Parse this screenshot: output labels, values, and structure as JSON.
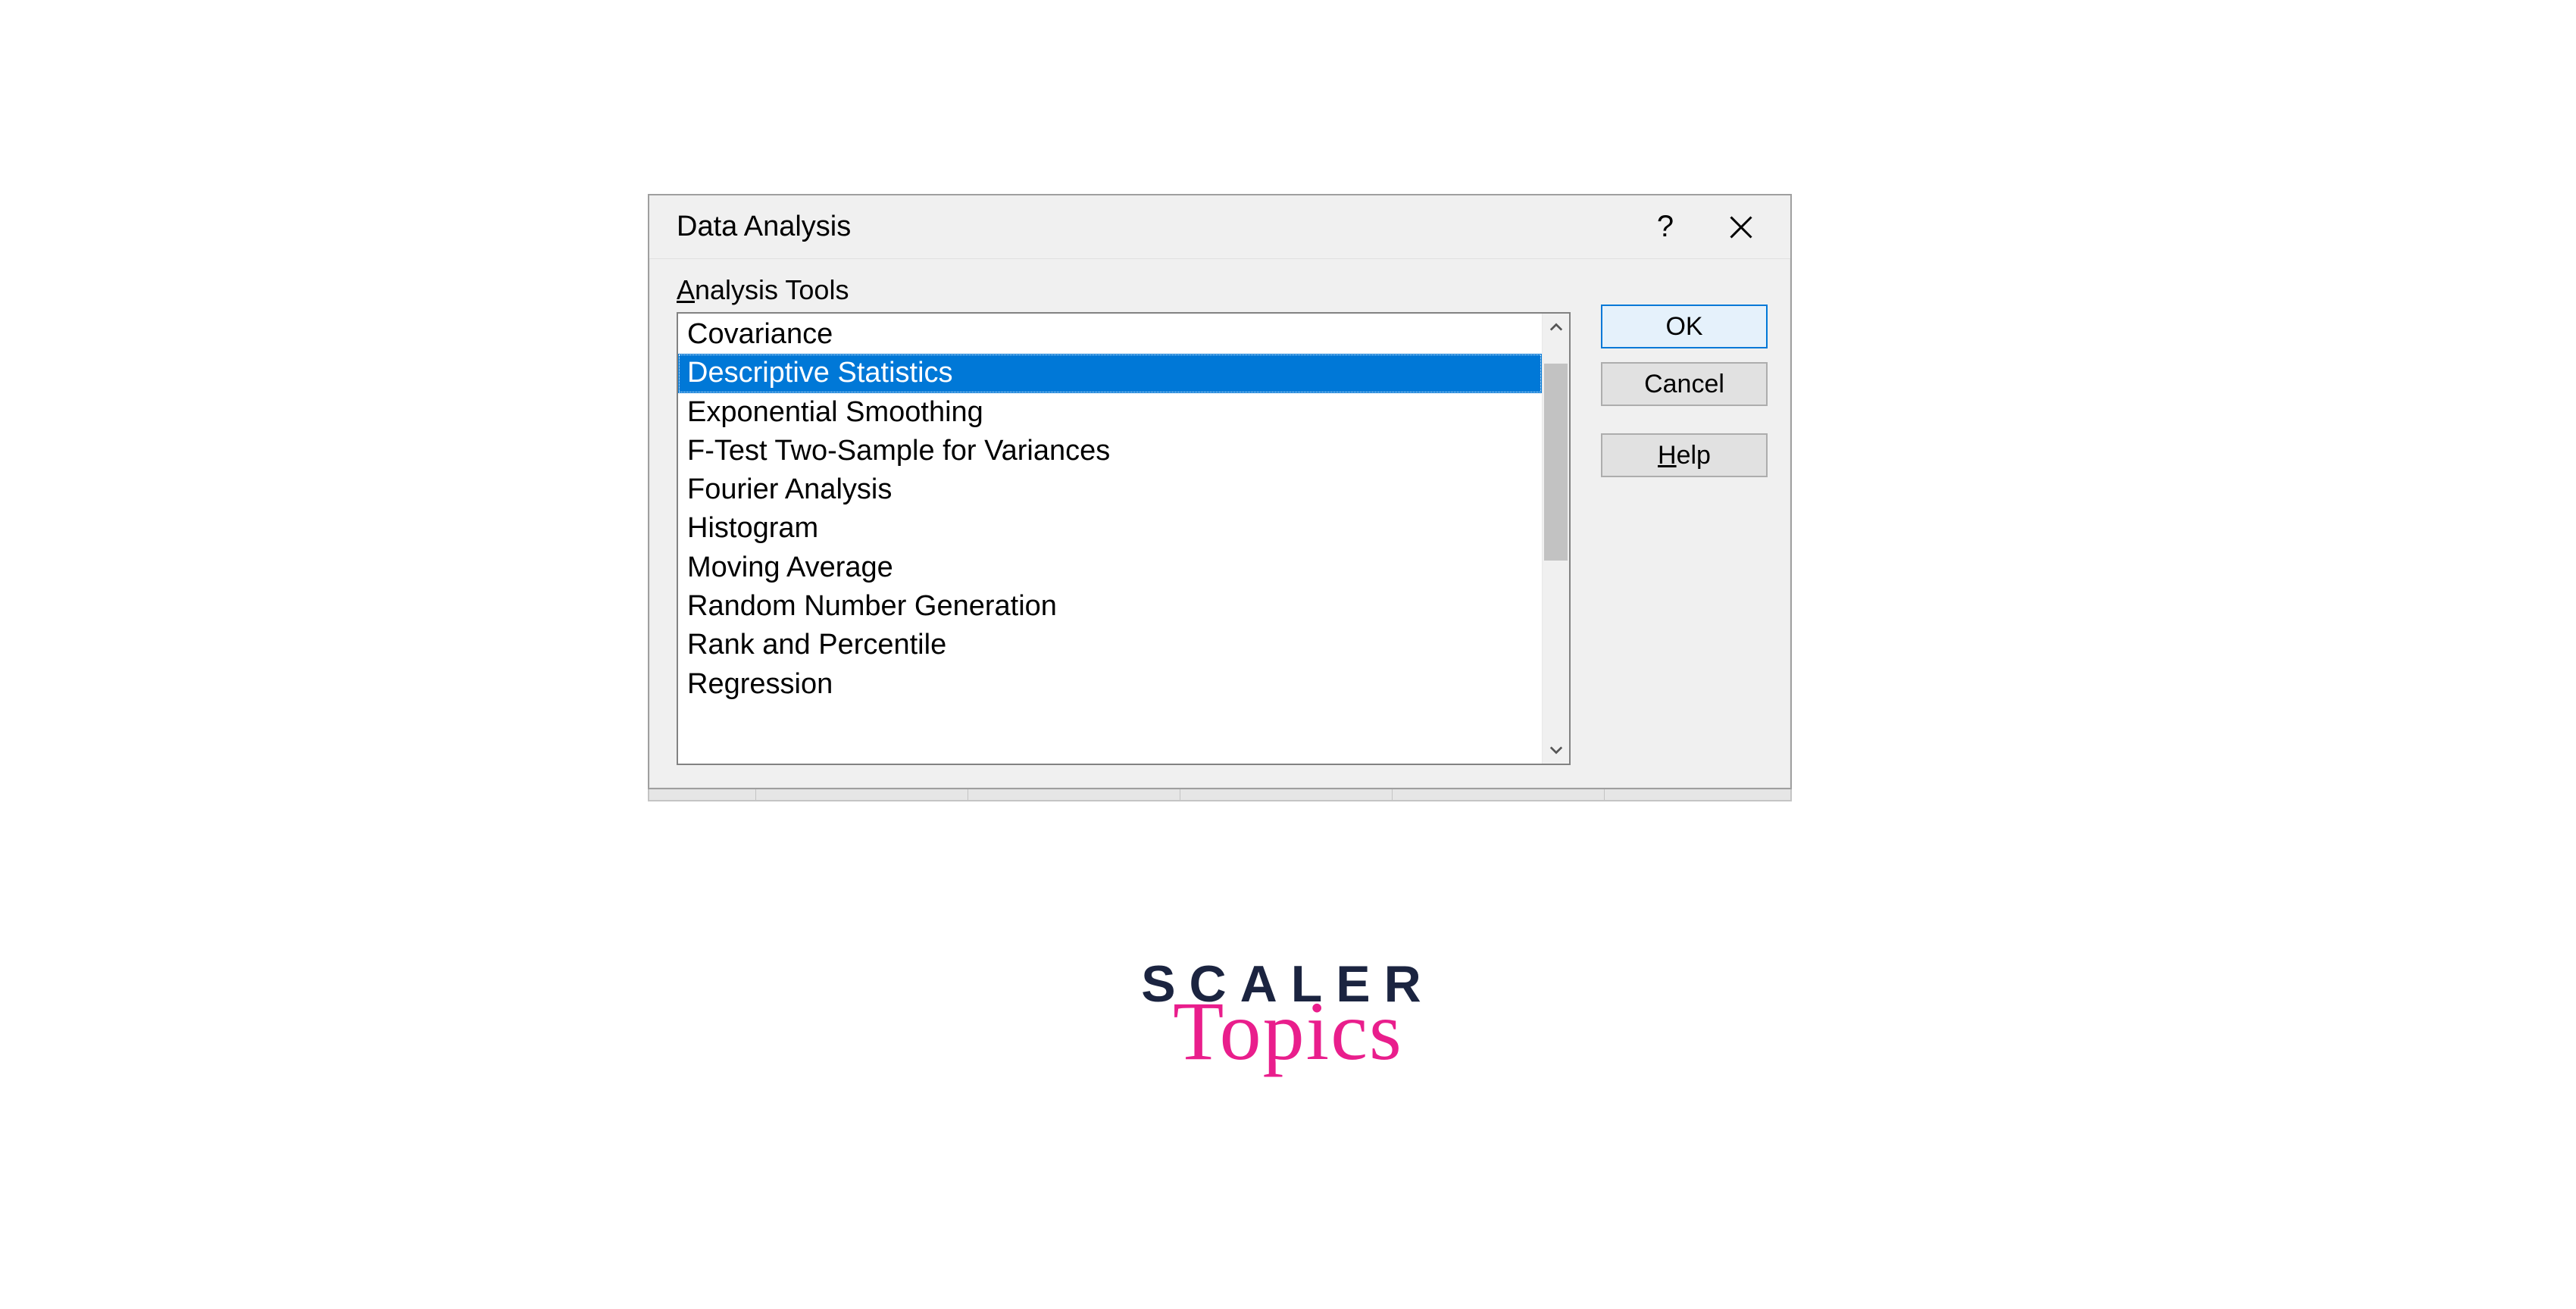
{
  "dialog": {
    "title": "Data Analysis",
    "section_label_prefix": "A",
    "section_label_rest": "nalysis Tools",
    "items": [
      "Covariance",
      "Descriptive Statistics",
      "Exponential Smoothing",
      "F-Test Two-Sample for Variances",
      "Fourier Analysis",
      "Histogram",
      "Moving Average",
      "Random Number Generation",
      "Rank and Percentile",
      "Regression"
    ],
    "selected_index": 1,
    "buttons": {
      "ok": "OK",
      "cancel": "Cancel",
      "help_prefix": "H",
      "help_rest": "elp"
    },
    "help_icon": "?"
  },
  "logo": {
    "line1": "SCALER",
    "line2": "Topics"
  }
}
